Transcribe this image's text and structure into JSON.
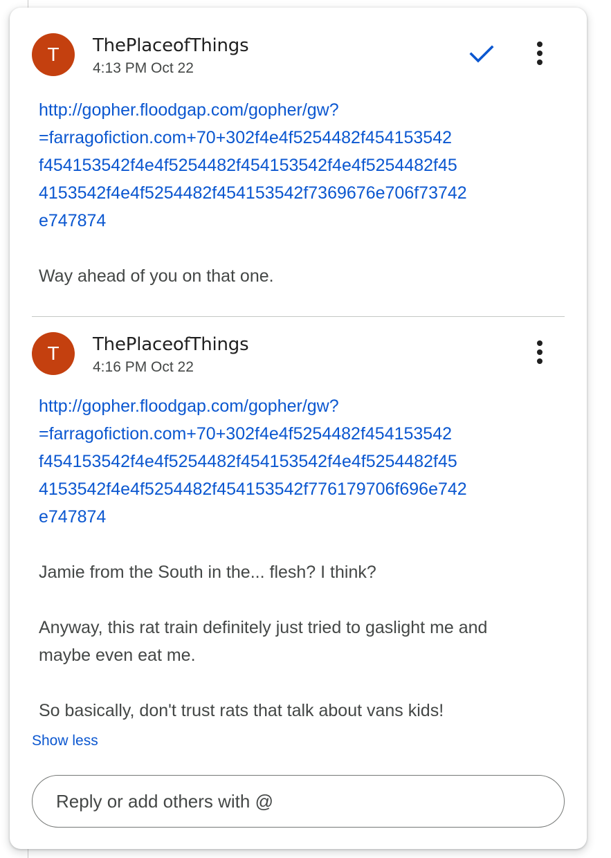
{
  "colors": {
    "avatar_bg": "#c4400f",
    "link": "#0b57d0",
    "accent_check": "#0b57d0",
    "text_primary": "#1f1f1f",
    "text_secondary": "#444746"
  },
  "comments": [
    {
      "avatar_letter": "T",
      "author": "ThePlaceofThings",
      "timestamp": "4:13 PM Oct 22",
      "resolve_icon": "check-icon",
      "more_icon": "more-vert-icon",
      "link_lines": [
        "http://gopher.floodgap.com/gopher/gw?",
        "=farragofiction.com+70+302f4e4f5254482f454153542",
        "f454153542f4e4f5254482f454153542f4e4f5254482f45",
        "4153542f4e4f5254482f454153542f7369676e706f73742",
        "e747874"
      ],
      "paragraphs": [
        "Way ahead of you on that one."
      ]
    },
    {
      "avatar_letter": "T",
      "author": "ThePlaceofThings",
      "timestamp": "4:16 PM Oct 22",
      "more_icon": "more-vert-icon",
      "link_lines": [
        "http://gopher.floodgap.com/gopher/gw?",
        "=farragofiction.com+70+302f4e4f5254482f454153542",
        "f454153542f4e4f5254482f454153542f4e4f5254482f45",
        "4153542f4e4f5254482f454153542f776179706f696e742",
        "e747874"
      ],
      "paragraphs": [
        "Jamie from the South in the... flesh? I think?",
        "Anyway, this rat train definitely just tried to gaslight me and maybe even eat me.",
        "So basically, don't trust rats that talk about vans kids!"
      ]
    }
  ],
  "show_less_label": "Show less",
  "reply": {
    "placeholder": "Reply or add others with @",
    "value": ""
  }
}
